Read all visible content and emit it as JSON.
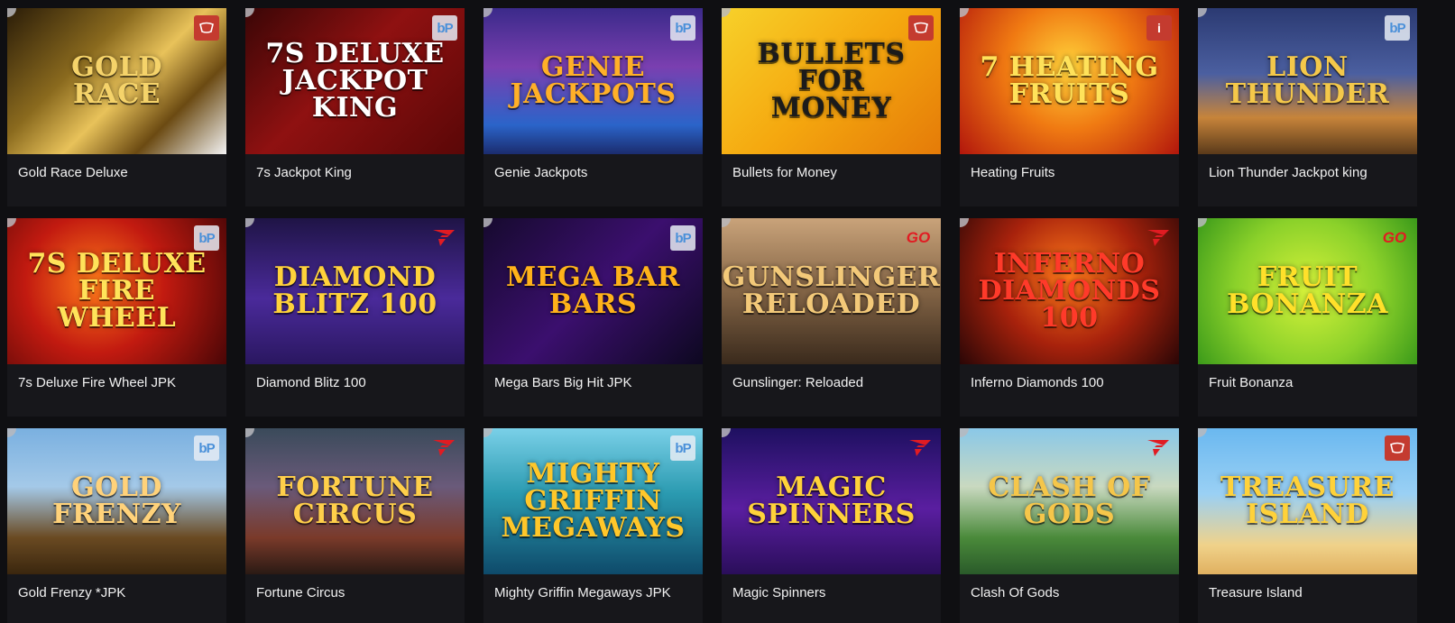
{
  "colors": {
    "page_bg": "#0f0f12",
    "card_bg": "#17171b",
    "title_text": "#f2f2f2"
  },
  "games": [
    {
      "title": "Gold Race Deluxe",
      "art_text": "GOLD RACE",
      "provider_icon": "red-cup-icon",
      "provider_label": "",
      "bg": "linear-gradient(135deg,#2a1c08 0%,#8a6a1e 35%,#e8c25a 55%,#6b4a12 75%,#f3f3f3 100%)",
      "fg": "#f5d36a"
    },
    {
      "title": "7s Jackpot King",
      "art_text": "7s DELUXE Jackpot KING",
      "provider_icon": "bp-icon",
      "provider_label": "bP",
      "bg": "linear-gradient(135deg,#3a0606 0%,#8f1111 45%,#5a0707 100%)",
      "fg": "#ffffff"
    },
    {
      "title": "Genie Jackpots",
      "art_text": "GENIE JACKPOTS",
      "provider_icon": "bp-icon",
      "provider_label": "bP",
      "bg": "linear-gradient(180deg,#3b2a8a 0%,#7a3fb0 40%,#2b64c9 80%,#1b2c6e 100%)",
      "fg": "#ffb028"
    },
    {
      "title": "Bullets for Money",
      "art_text": "BULLETS for MONEY",
      "provider_icon": "red-cup-icon",
      "provider_label": "",
      "bg": "linear-gradient(135deg,#f7d12a 0%,#f5a80f 50%,#e57b08 100%)",
      "fg": "#1b1b1b"
    },
    {
      "title": "Heating Fruits",
      "art_text": "7 HEATING FRUITS",
      "provider_icon": "info-icon",
      "provider_label": "i",
      "bg": "radial-gradient(circle at 50% 40%,#ffd23a 0%,#f07a12 45%,#b2160c 100%)",
      "fg": "#ffe25a"
    },
    {
      "title": "Lion Thunder Jackpot king",
      "art_text": "LION THUNDER",
      "provider_icon": "bp-icon",
      "provider_label": "bP",
      "bg": "linear-gradient(180deg,#2b3a72 0%,#4b5fa0 45%,#c7843a 75%,#5a3a1a 100%)",
      "fg": "#f4c84a"
    },
    {
      "title": "7s Deluxe Fire Wheel JPK",
      "art_text": "7s DELUXE FIRE WHEEL",
      "provider_icon": "bp-icon",
      "provider_label": "bP",
      "bg": "radial-gradient(circle at 40% 45%,#ff7a1a 0%,#c21a10 45%,#4a0606 100%)",
      "fg": "#ffe35a"
    },
    {
      "title": "Diamond Blitz 100",
      "art_text": "DIAMOND BLITZ 100",
      "provider_icon": "fg-icon",
      "provider_label": "",
      "bg": "linear-gradient(180deg,#1f1446 0%,#4a2a9a 55%,#2a1760 100%)",
      "fg": "#ffd23a"
    },
    {
      "title": "Mega Bars Big Hit JPK",
      "art_text": "MEGA BAR Bars",
      "provider_icon": "bp-icon",
      "provider_label": "bP",
      "bg": "linear-gradient(135deg,#160a2e 0%,#3b0f6e 50%,#0d0820 100%)",
      "fg": "#ffb21a"
    },
    {
      "title": "Gunslinger: Reloaded",
      "art_text": "GUNSLINGER RELOADED",
      "provider_icon": "go-icon",
      "provider_label": "GO",
      "bg": "linear-gradient(180deg,#c9a37a 0%,#8a6a4a 45%,#3a2a1c 100%)",
      "fg": "#f3c979"
    },
    {
      "title": "Inferno Diamonds 100",
      "art_text": "INFERNO Diamonds 100",
      "provider_icon": "fg-icon",
      "provider_label": "",
      "bg": "radial-gradient(circle at 50% 40%,#ff7a1a 0%,#a8220c 50%,#2a0606 100%)",
      "fg": "#ff3a2a"
    },
    {
      "title": "Fruit Bonanza",
      "art_text": "FRUIT BONANZA",
      "provider_icon": "go-icon",
      "provider_label": "GO",
      "bg": "radial-gradient(circle at 50% 50%,#d6f23a 0%,#8bd12a 55%,#3b9a1a 100%)",
      "fg": "#ffe02a"
    },
    {
      "title": "Gold Frenzy *JPK",
      "art_text": "GOLD FRENZY",
      "provider_icon": "bp-icon",
      "provider_label": "bP",
      "bg": "linear-gradient(180deg,#7ab0e0 0%,#a4c9e8 40%,#6a4a22 75%,#3a260e 100%)",
      "fg": "#ffd27a"
    },
    {
      "title": "Fortune Circus",
      "art_text": "FORTUNE CIRCUS",
      "provider_icon": "fg-icon",
      "provider_label": "",
      "bg": "linear-gradient(180deg,#3a4a5a 0%,#6a5a7a 40%,#7a3a2a 75%,#2a1a14 100%)",
      "fg": "#ffcf4a"
    },
    {
      "title": "Mighty Griffin Megaways JPK",
      "art_text": "MIGHTY GRIFFIN MEGAWAYS",
      "provider_icon": "bp-icon",
      "provider_label": "bP",
      "bg": "linear-gradient(180deg,#7ad0e8 0%,#2a9ab0 45%,#0e4a6a 100%)",
      "fg": "#ffc72a"
    },
    {
      "title": "Magic Spinners",
      "art_text": "MAGIC SPINNERS",
      "provider_icon": "fg-icon",
      "provider_label": "",
      "bg": "linear-gradient(180deg,#1e1060 0%,#5a1ea0 55%,#2a0e5a 100%)",
      "fg": "#ffd23a"
    },
    {
      "title": "Clash Of Gods",
      "art_text": "CLASH OF GODS",
      "provider_icon": "fg-icon",
      "provider_label": "",
      "bg": "linear-gradient(180deg,#8ac8e8 0%,#c9d9c0 40%,#4a8a3a 75%,#2a5a2a 100%)",
      "fg": "#f5c64a"
    },
    {
      "title": "Treasure Island",
      "art_text": "TREASURE ISLAND",
      "provider_icon": "red-cup-icon",
      "provider_label": "",
      "bg": "linear-gradient(180deg,#6ab8f0 0%,#9ad0f4 45%,#f0d28a 80%,#e0b060 100%)",
      "fg": "#ffd23a"
    }
  ]
}
